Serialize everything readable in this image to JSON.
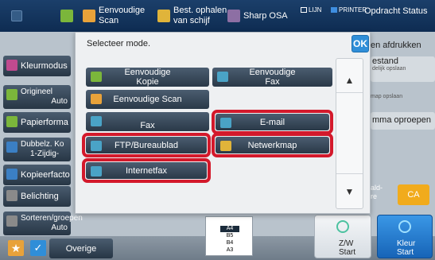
{
  "topbar": {
    "items": [
      {
        "label": "Eenvoudige\nScan",
        "icon": "scan-icon",
        "color": "#e8a23a"
      },
      {
        "label": "Best. ophalen\nvan schijf",
        "icon": "folder-icon",
        "color": "#e0b43a"
      },
      {
        "label": "Sharp OSA",
        "icon": "sharp-osa-icon",
        "color": "#8d6fa4"
      }
    ],
    "status_lijn": "LIJN",
    "status_printer": "PRINTER",
    "opdracht_status": "Opdracht Status"
  },
  "background": {
    "left_buttons": [
      {
        "label": "Kleurmodus",
        "icon": "color-mode-icon",
        "color": "#c04a8f"
      },
      {
        "label": "Origineel",
        "sub": "Auto",
        "icon": "original-icon",
        "color": "#7bb63b"
      },
      {
        "label": "Papierforma",
        "icon": "paper-icon",
        "color": "#7bb63b"
      },
      {
        "label": "Dubbelz. Ko",
        "sub": "1-Zijdig-",
        "icon": "duplex-icon",
        "color": "#3b7fc4"
      },
      {
        "label": "Kopieerfacto",
        "icon": "zoom-icon",
        "color": "#3b7fc4"
      },
      {
        "label": "Belichting",
        "icon": "exposure-icon",
        "color": "#8a8a8a"
      },
      {
        "label": "Sorteren/groepen",
        "sub": "Auto",
        "icon": "sort-icon",
        "color": "#8a8a8a"
      }
    ],
    "right_items": [
      {
        "label": "en afdrukken"
      },
      {
        "label": "estand",
        "sub": "delijk opslaan"
      },
      {
        "label": "map opslaan"
      },
      {
        "label": "mma oproepen"
      }
    ],
    "right_bottom": {
      "label": "ald-",
      "label2": "re"
    },
    "ca_button": "CA",
    "overige": "Overige",
    "zw_start": "Z/W\nStart",
    "kleur_start": "Kleur\nStart",
    "paper_sizes": [
      "A4",
      "B5",
      "B4",
      "A3"
    ]
  },
  "modal": {
    "title": "Selecteer mode.",
    "ok_label": "OK",
    "buttons": [
      {
        "label": "Eenvoudige\nKopie",
        "icon": "copy-icon",
        "color": "#7bb63b"
      },
      {
        "label": "Eenvoudige\nFax",
        "icon": "fax-icon",
        "color": "#4aa3c6"
      },
      {
        "label": "Eenvoudige Scan",
        "icon": "scan-icon",
        "color": "#e8a23a"
      },
      {
        "label": "Fax",
        "icon": "fax-icon",
        "color": "#4aa3c6"
      },
      {
        "label": "E-mail",
        "icon": "email-icon",
        "color": "#4aa3c6"
      },
      {
        "label": "FTP/Bureaublad",
        "icon": "ftp-icon",
        "color": "#4aa3c6"
      },
      {
        "label": "Netwerkmap",
        "icon": "network-folder-icon",
        "color": "#e0b43a"
      },
      {
        "label": "Internetfax",
        "icon": "internet-fax-icon",
        "color": "#4aa3c6"
      }
    ],
    "scroll_up": "▲",
    "scroll_down": "▼"
  }
}
